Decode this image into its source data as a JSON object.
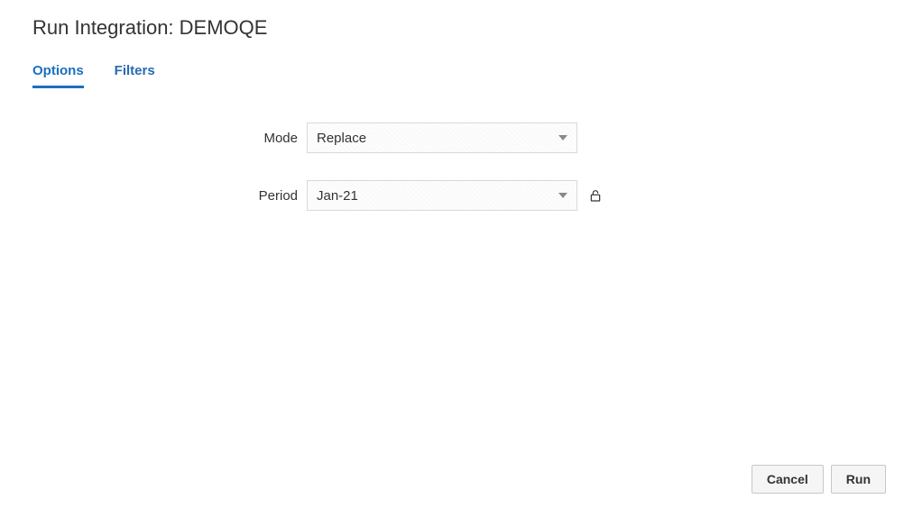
{
  "header": {
    "title": "Run Integration: DEMOQE"
  },
  "tabs": {
    "options": "Options",
    "filters": "Filters"
  },
  "form": {
    "mode": {
      "label": "Mode",
      "value": "Replace"
    },
    "period": {
      "label": "Period",
      "value": "Jan-21"
    }
  },
  "footer": {
    "cancel": "Cancel",
    "run": "Run"
  }
}
